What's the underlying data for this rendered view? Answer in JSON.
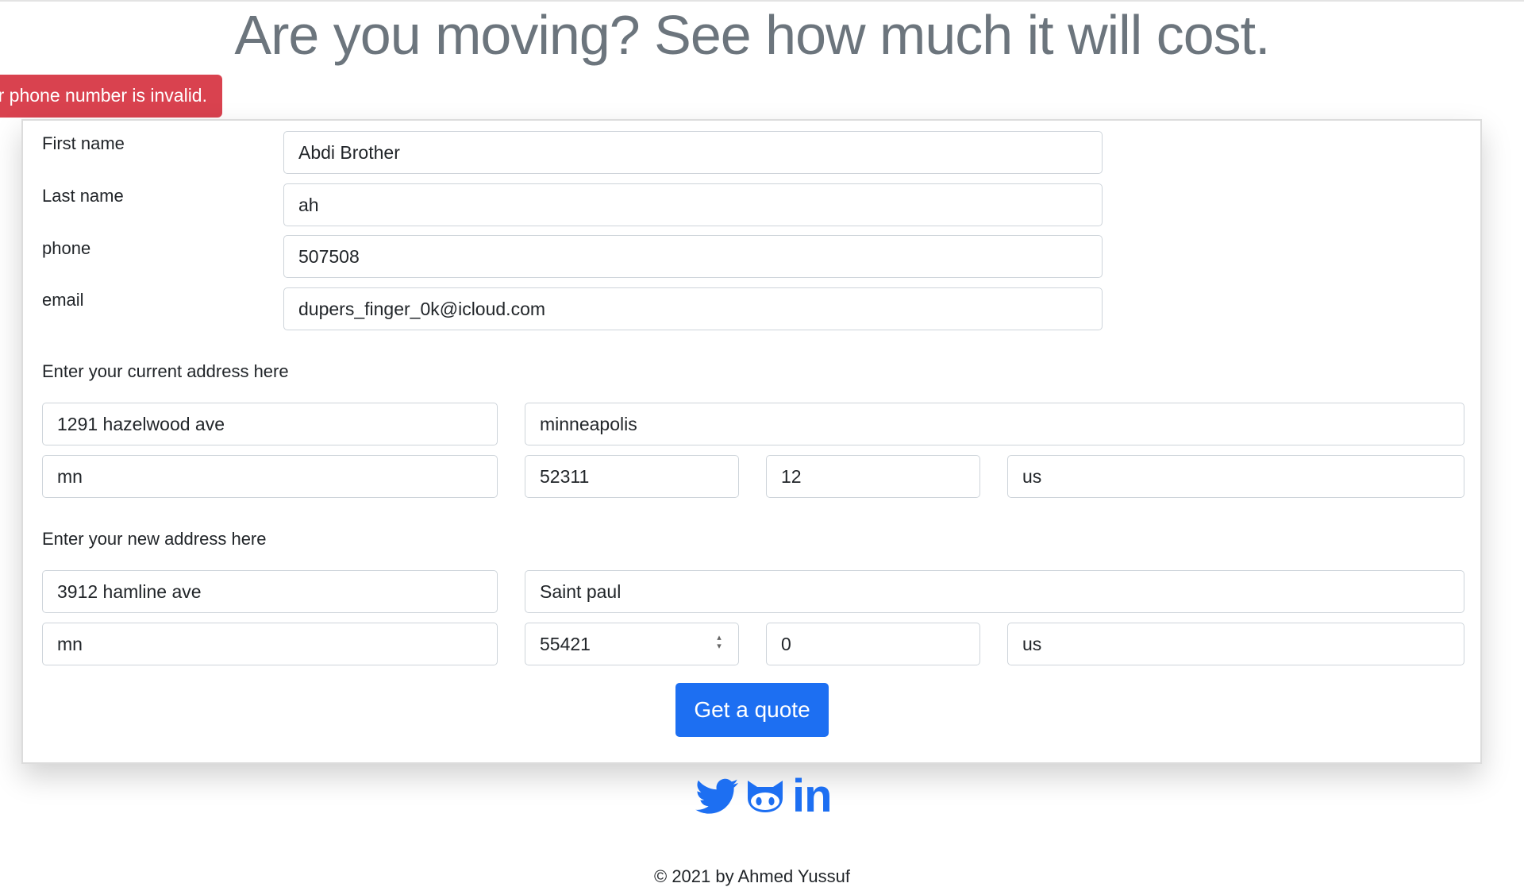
{
  "page": {
    "headline": "Are you moving? See how much it will cost.",
    "alert_text": "r phone number is invalid.",
    "footer": "© 2021 by Ahmed Yussuf"
  },
  "form": {
    "first_name_label": "First name",
    "first_name_value": "Abdi Brother",
    "last_name_label": "Last name",
    "last_name_value": "ah",
    "phone_label": "phone",
    "phone_value": "507508",
    "email_label": "email",
    "email_value": "dupers_finger_0k@icloud.com",
    "current_address_heading": "Enter your current address here",
    "current": {
      "street": "1291 hazelwood ave",
      "city": "minneapolis",
      "state": "mn",
      "zip": "52311",
      "unit": "12",
      "country": "us"
    },
    "new_address_heading": "Enter your new address here",
    "new": {
      "street": "3912 hamline ave",
      "city": "Saint paul",
      "state": "mn",
      "zip": "55421",
      "unit": "0",
      "country": "us"
    },
    "submit_label": "Get a quote"
  },
  "social": {
    "accent_color": "#1d6ff2",
    "icons": [
      "twitter-icon",
      "github-icon",
      "linkedin-icon"
    ],
    "linkedin_text": "in"
  },
  "colors": {
    "alert_bg": "#d9424f",
    "button_bg": "#1d6ff2",
    "headline": "#6c757d"
  }
}
